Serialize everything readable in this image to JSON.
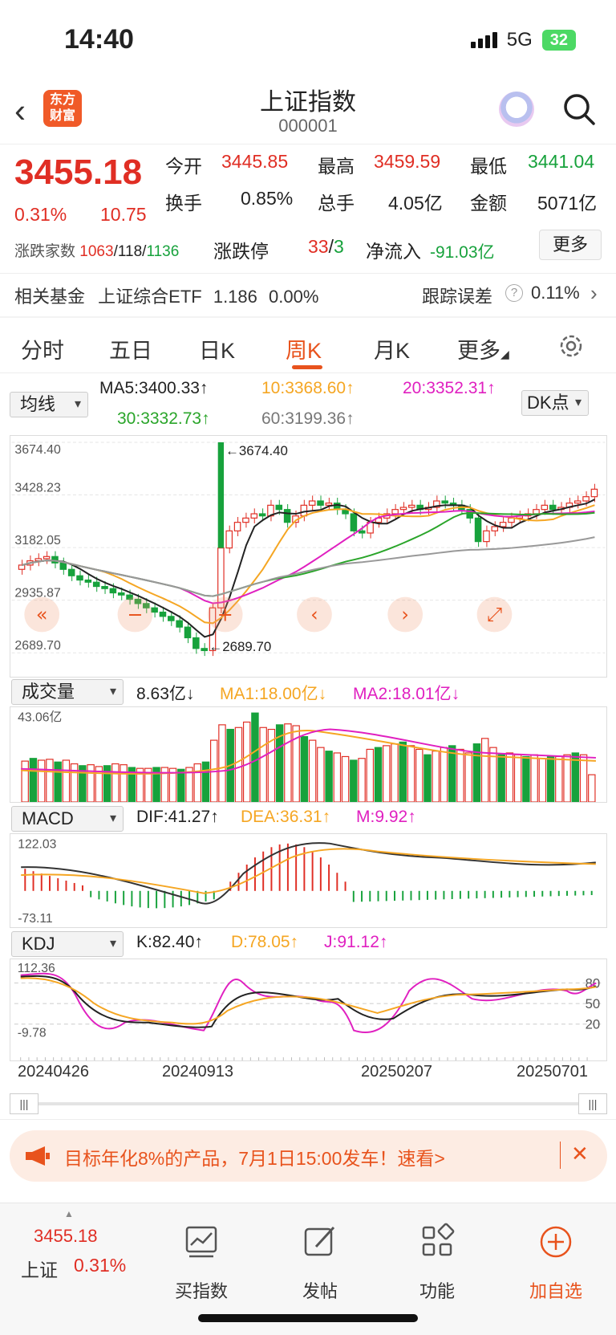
{
  "status_bar": {
    "time": "14:40",
    "network": "5G",
    "battery": "32"
  },
  "header": {
    "back_icon": "chevron-left-icon",
    "logo_line1": "东方",
    "logo_line2": "财富",
    "title": "上证指数",
    "code": "000001",
    "assistant_icon": "robot-icon",
    "search_icon": "search-icon"
  },
  "quote": {
    "price": "3455.18",
    "change_pct": "0.31%",
    "change_pts": "10.75",
    "open_label": "今开",
    "open": "3445.85",
    "high_label": "最高",
    "high": "3459.59",
    "low_label": "最低",
    "low": "3441.04",
    "turnover_label": "换手",
    "turnover": "0.85%",
    "volume_label": "总手",
    "volume": "4.05亿",
    "amount_label": "金额",
    "amount": "5071亿",
    "breadth_label": "涨跌家数",
    "breadth_up": "1063",
    "breadth_flat": "118",
    "breadth_down": "1136",
    "limit_label": "涨跌停",
    "limit_up": "33",
    "limit_down": "3",
    "inflow_label": "净流入",
    "inflow": "-91.03亿",
    "more_label": "更多"
  },
  "fund": {
    "label": "相关基金",
    "name": "上证综合ETF",
    "price": "1.186",
    "change": "0.00%",
    "tracking_label": "跟踪误差",
    "tracking_value": "0.11%"
  },
  "tabs": [
    "分时",
    "五日",
    "日K",
    "周K",
    "月K",
    "更多"
  ],
  "active_tab": "周K",
  "main_chart": {
    "selector": "均线",
    "ma5": "MA5:3400.33↑",
    "ma10": "10:3368.60↑",
    "ma20": "20:3352.31↑",
    "ma30": "30:3332.73↑",
    "ma60": "60:3199.36↑",
    "dk_label": "DK点",
    "y_labels": [
      "3674.40",
      "3428.23",
      "3182.05",
      "2935.87",
      "2689.70"
    ],
    "max_label": "←3674.40",
    "min_label": "←2689.70"
  },
  "volume_panel": {
    "selector": "成交量",
    "value": "8.63亿↓",
    "ma1": "MA1:18.00亿↓",
    "ma2": "MA2:18.01亿↓",
    "top_label": "43.06亿"
  },
  "macd_panel": {
    "selector": "MACD",
    "dif": "DIF:41.27↑",
    "dea": "DEA:36.31↑",
    "m": "M:9.92↑",
    "top_label": "122.03",
    "bottom_label": "-73.11"
  },
  "kdj_panel": {
    "selector": "KDJ",
    "k": "K:82.40↑",
    "d": "D:78.05↑",
    "j": "J:91.12↑",
    "top_label": "112.36",
    "bottom_label": "-9.78",
    "levels": [
      "80",
      "50",
      "20"
    ]
  },
  "dates": [
    "20240426",
    "20240913",
    "20250207",
    "20250701"
  ],
  "promo": {
    "text": "目标年化8%的产品，7月1日15:00发车！速看>",
    "close": "✕"
  },
  "bottom_nav": {
    "price": "3455.18",
    "index_name": "上证",
    "change": "0.31%",
    "items": [
      "买指数",
      "发帖",
      "功能",
      "加自选"
    ]
  },
  "colors": {
    "up": "#e02e24",
    "down": "#17a23c",
    "accent": "#e8531d",
    "ma10": "#f5a623",
    "ma20": "#e020c0",
    "ma30": "#2aa52a",
    "ma60": "#999999"
  }
}
